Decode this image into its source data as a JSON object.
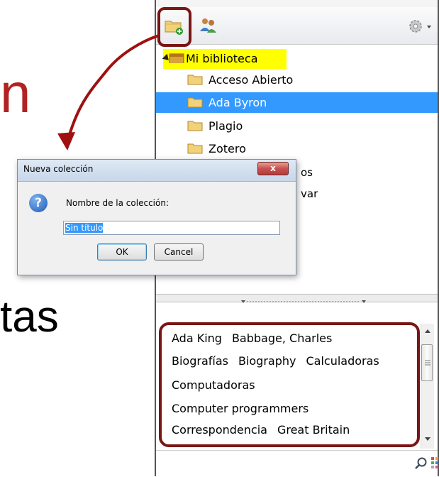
{
  "slide": {
    "fragment_top": "n",
    "fragment_bottom": "tas"
  },
  "toolbar": {
    "new_collection_icon": "folder-add-icon",
    "new_group_icon": "group-add-icon",
    "actions_icon": "gear-icon"
  },
  "tree": {
    "root": "Mi biblioteca",
    "items": [
      {
        "label": "Acceso Abierto",
        "selected": false
      },
      {
        "label": "Ada Byron",
        "selected": true
      },
      {
        "label": "Plagio",
        "selected": false
      },
      {
        "label": "Zotero",
        "selected": false
      }
    ],
    "hidden_fragments": [
      "os",
      "var"
    ]
  },
  "tags": {
    "lines": [
      [
        "Ada King",
        "Babbage, Charles"
      ],
      [
        "Biografías",
        "Biography",
        "Calculadoras"
      ],
      [
        "Computadoras"
      ],
      [
        "Computer programmers"
      ],
      [
        "Correspondencia",
        "Great Britain"
      ]
    ]
  },
  "dialog": {
    "title": "Nueva colección",
    "close_label": "x",
    "help_icon_text": "?",
    "prompt": "Nombre de la colección:",
    "input_value": "Sin título",
    "ok_label": "OK",
    "cancel_label": "Cancel"
  },
  "colors": {
    "selection": "#3399ff",
    "root_highlight": "#ffff00",
    "annotation": "#7a1515"
  }
}
